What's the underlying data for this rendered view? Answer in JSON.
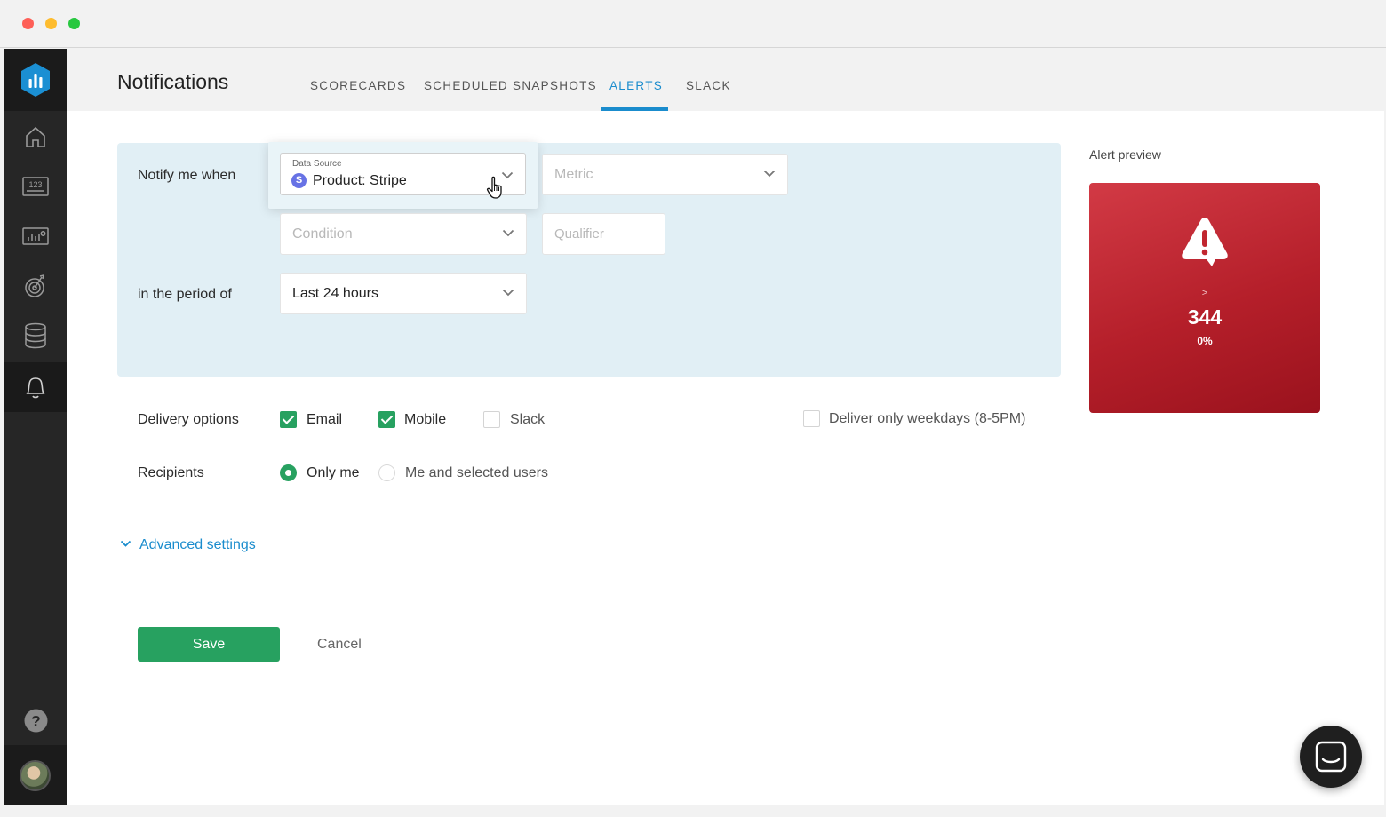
{
  "window": {
    "controls": [
      "close",
      "minimize",
      "maximize"
    ]
  },
  "sidebar": {
    "logo_icon": "databox-logo-icon",
    "items": [
      {
        "name": "home",
        "icon": "home-icon"
      },
      {
        "name": "scorecards",
        "icon": "numbers-123-icon"
      },
      {
        "name": "databoards",
        "icon": "dashboard-chart-icon"
      },
      {
        "name": "goals",
        "icon": "target-icon"
      },
      {
        "name": "data-sources",
        "icon": "database-icon"
      },
      {
        "name": "alerts",
        "icon": "bell-icon",
        "active": true
      }
    ],
    "help_icon": "help-icon"
  },
  "header": {
    "title": "Notifications",
    "tabs": [
      {
        "label": "SCORECARDS",
        "active": false
      },
      {
        "label": "SCHEDULED SNAPSHOTS",
        "active": false
      },
      {
        "label": "ALERTS",
        "active": true
      },
      {
        "label": "SLACK",
        "active": false
      }
    ]
  },
  "form": {
    "notify_label": "Notify me when",
    "data_source": {
      "label": "Data Source",
      "value": "Product: Stripe",
      "icon_letter": "S"
    },
    "metric": {
      "placeholder": "Metric"
    },
    "condition": {
      "placeholder": "Condition"
    },
    "qualifier": {
      "placeholder": "Qualifier"
    },
    "period_label": "in the period of",
    "period": {
      "value": "Last 24 hours"
    },
    "delivery": {
      "label": "Delivery options",
      "options": [
        {
          "label": "Email",
          "checked": true
        },
        {
          "label": "Mobile",
          "checked": true
        },
        {
          "label": "Slack",
          "checked": false
        }
      ],
      "weekdays": {
        "label": "Deliver only weekdays (8-5PM)",
        "checked": false
      }
    },
    "recipients": {
      "label": "Recipients",
      "options": [
        {
          "label": "Only me",
          "selected": true
        },
        {
          "label": "Me and selected users",
          "selected": false
        }
      ]
    },
    "advanced_label": "Advanced settings",
    "save_label": "Save",
    "cancel_label": "Cancel"
  },
  "preview": {
    "title": "Alert preview",
    "operator": ">",
    "value": "344",
    "percent": "0%",
    "colors": {
      "start": "#d23a45",
      "end": "#9a121d"
    }
  },
  "colors": {
    "accent": "#1a8ccd",
    "success": "#27a160",
    "panel": "#e1eff5"
  }
}
